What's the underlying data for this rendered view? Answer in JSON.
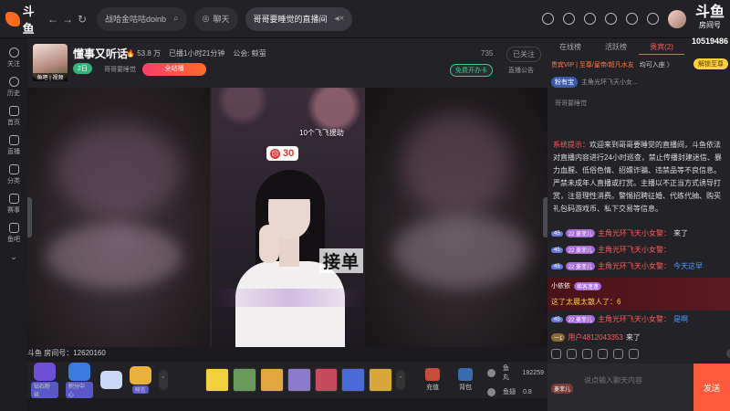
{
  "topbar": {
    "logo": "斗鱼",
    "back": "←",
    "forward": "→",
    "refresh": "↻",
    "tabs": [
      {
        "label": "战哈金咕咕doinb"
      },
      {
        "label": "聊天"
      },
      {
        "label": "哥哥要睡觉的直播间"
      }
    ],
    "brand_line1": "斗鱼",
    "brand_line2": "房间号",
    "room_id_display": "10519486"
  },
  "leftbar": {
    "items": [
      {
        "label": "关注"
      },
      {
        "label": "历史"
      },
      {
        "label": "首页"
      },
      {
        "label": "直播"
      },
      {
        "label": "分类"
      },
      {
        "label": "赛事"
      },
      {
        "label": "鱼吧"
      }
    ]
  },
  "room": {
    "name": "懂事又听话",
    "heat": "53.8 万",
    "live_time": "已播1小时21分钟",
    "notice": "公会: 鲸萤",
    "level": "2日",
    "category": "哥哥要睡觉",
    "quanzhan": "全站播",
    "avatar_tag": "鱼吧 | 视频",
    "viewer_count": "735",
    "followed": "已关注",
    "free_card": "免费开办卡",
    "announcement": "直播公告",
    "room_number": "斗鱼 房间号：12620160"
  },
  "video": {
    "gift_tip": "10个飞飞援助",
    "gift_count": "30",
    "overlay_text": "接单"
  },
  "bottombar": {
    "items": [
      {
        "label": "钻石粉丝",
        "color": "#6e4fd6"
      },
      {
        "label": "积分中心",
        "color": "#3b7be0"
      },
      {
        "label": "",
        "color": "#c9d8f5"
      },
      {
        "label": "预言",
        "color": "#e8b23a"
      }
    ],
    "gifts": [
      "#f1d23a",
      "#6a9b5a",
      "#e4a640",
      "#8a7ac9",
      "#c44c5c",
      "#4a6ad8",
      "#d9a63a"
    ],
    "recharge": "充值",
    "backpack": "背包",
    "fish_ball_label": "鱼丸",
    "fish_ball_value": "192259",
    "fish_fin_label": "鱼翅",
    "fish_fin_value": "0.8"
  },
  "rightpanel": {
    "tabs": [
      {
        "label": "在线榜"
      },
      {
        "label": "活跃榜"
      },
      {
        "label": "贵宾(2)"
      }
    ],
    "vip_line": "贵宾VIP | 至尊/皇帝/超凡水友",
    "vip_more": "均可入座 〉",
    "unlock": "解锁至尊",
    "fans_badge": "粉有宝",
    "fans_name": "主角光环飞天小女...",
    "anchor_name": "哥哥要睡觉",
    "system_tag": "系统提示：",
    "system_text": "欢迎来到哥哥要睡觉的直播间，斗鱼依法对直播内容进行24小时巡查，禁止传播封建迷信、暴力血腥、低俗色情、招嫖诈骗、违禁品等不良信息。严禁未成年人直播或打赏。主播以不正当方式诱导打赏，注意理性消费。警惕招聘征婚、代练代抽、购买礼包码游戏币、私下交易等信息。",
    "chats": [
      {
        "lv": "45",
        "fan": "22 菱菲儿",
        "user": "主角光环飞天小女警：",
        "msg": "来了",
        "blue": false
      },
      {
        "lv": "45",
        "fan": "22 菱菲儿",
        "user": "主角光环飞天小女警：",
        "msg": "",
        "blue": false
      },
      {
        "lv": "45",
        "fan": "22 菱菲儿",
        "user": "主角光环飞天小女警：",
        "msg": "今天这早",
        "blue": true
      }
    ],
    "highlight_user": "小依依",
    "highlight_badge": "稀客蓬蓬",
    "highlight_msg": "这了太晨太散人了：6",
    "chat_after": {
      "lv": "45",
      "fan": "22 菱菲儿",
      "user": "主角光环飞天小女警：",
      "msg": "是啊"
    },
    "join_lv": "一1",
    "join_user": "用户4812043353",
    "join_msg": "来了",
    "input_badge": "菱菲儿",
    "input_placeholder": "说点输入聊天内容",
    "send": "发送"
  }
}
